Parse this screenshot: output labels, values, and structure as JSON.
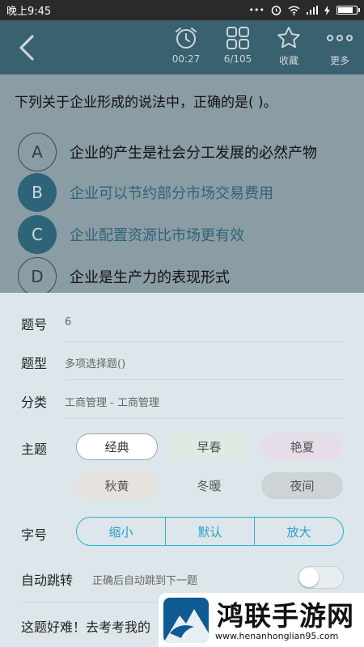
{
  "status_bar": {
    "time": "晚上9:45",
    "signal_text": "ull",
    "battery_level": 0.85
  },
  "toolbar": {
    "timer": "00:27",
    "progress": "6/105",
    "favorite_label": "收藏",
    "more_label": "更多"
  },
  "question": {
    "stem": "下列关于企业形成的说法中，正确的是(  )。",
    "options": [
      {
        "letter": "A",
        "text": "企业的产生是社会分工发展的必然产物",
        "selected": false
      },
      {
        "letter": "B",
        "text": "企业可以节约部分市场交易费用",
        "selected": true
      },
      {
        "letter": "C",
        "text": "企业配置资源比市场更有效",
        "selected": true
      },
      {
        "letter": "D",
        "text": "企业是生产力的表现形式",
        "selected": false
      }
    ]
  },
  "sheet": {
    "number_label": "题号",
    "number_value": "6",
    "type_label": "题型",
    "type_value": "多项选择题()",
    "category_label": "分类",
    "category_value": "工商管理 - 工商管理",
    "theme_label": "主题",
    "themes": [
      "经典",
      "早春",
      "艳夏",
      "秋黄",
      "冬暖",
      "夜间"
    ],
    "active_theme": "经典",
    "font_label": "字号",
    "font_options": [
      "缩小",
      "默认",
      "放大"
    ],
    "auto_label": "自动跳转",
    "auto_desc": "正确后自动跳到下一题",
    "auto_enabled": false,
    "bottom_text": "这题好难！去考考我的"
  },
  "watermark": {
    "title": "鸿联手游网",
    "url": "www.henanhonglian95.com"
  },
  "colors": {
    "toolbar": "#3a6170",
    "selected_option": "#2e6478",
    "accent": "#2bb0d8",
    "sheet": "#dde6ea",
    "theme_backgrounds": [
      "#ffffff",
      "#dfeae2",
      "#e6dde8",
      "#e7e2dd",
      "#dde6ea",
      "#cdd3d6"
    ]
  }
}
